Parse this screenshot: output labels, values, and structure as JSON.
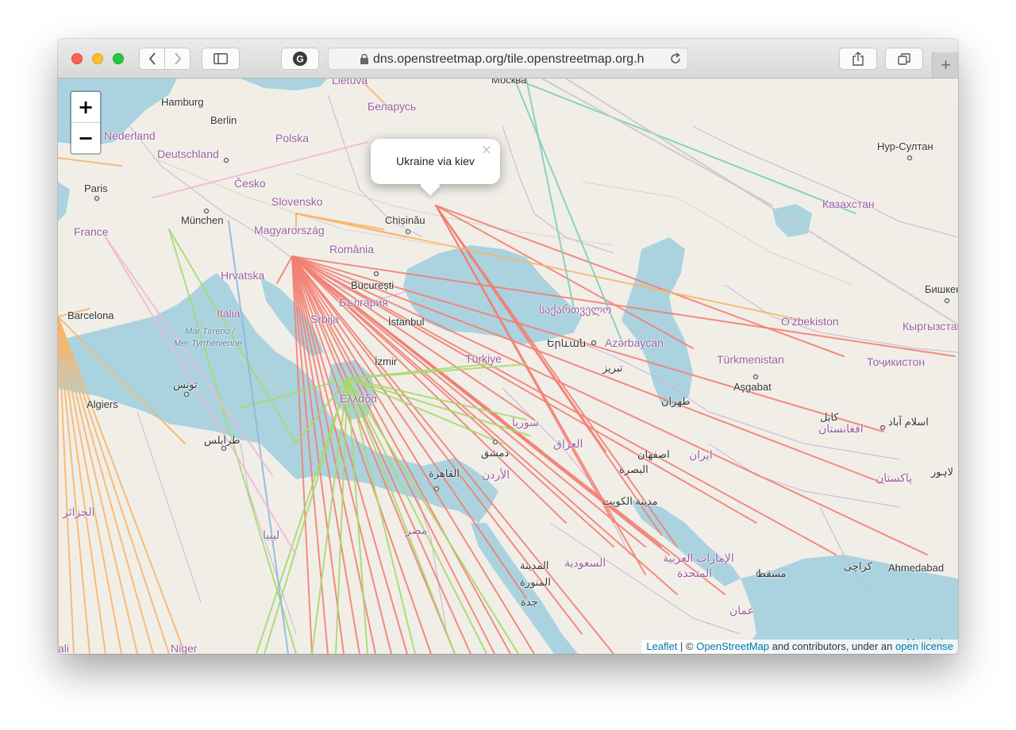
{
  "browser": {
    "url": "dns.openstreetmap.org/tile.openstreetmap.org.h",
    "new_tab_glyph": "+"
  },
  "map": {
    "zoom_in": "+",
    "zoom_out": "−",
    "popup": {
      "text": "Ukraine via kiev",
      "close": "×"
    },
    "attribution": {
      "leaflet": "Leaflet",
      "sep": " | © ",
      "osm": "OpenStreetMap",
      "middle": " and contributors, under an ",
      "license": "open license"
    },
    "labels": [
      {
        "text": "Hamburg",
        "cls": "lbl"
      },
      {
        "text": "Berlin",
        "cls": "lbl"
      },
      {
        "text": "Nederland",
        "cls": "lbl country"
      },
      {
        "text": "Deutschland",
        "cls": "lbl country"
      },
      {
        "text": "Polska",
        "cls": "lbl country"
      },
      {
        "text": "Беларусь",
        "cls": "lbl country"
      },
      {
        "text": "Česko",
        "cls": "lbl country"
      },
      {
        "text": "Slovensko",
        "cls": "lbl country"
      },
      {
        "text": "Paris",
        "cls": "lbl"
      },
      {
        "text": "München",
        "cls": "lbl"
      },
      {
        "text": "France",
        "cls": "lbl country"
      },
      {
        "text": "Magyarország",
        "cls": "lbl country"
      },
      {
        "text": "Chișinău",
        "cls": "lbl"
      },
      {
        "text": "România",
        "cls": "lbl country"
      },
      {
        "text": "Hrvatska",
        "cls": "lbl country"
      },
      {
        "text": "București",
        "cls": "lbl"
      },
      {
        "text": "България",
        "cls": "lbl country"
      },
      {
        "text": "Italia",
        "cls": "lbl country"
      },
      {
        "text": "Barcelona",
        "cls": "lbl"
      },
      {
        "text": "İstanbul",
        "cls": "lbl"
      },
      {
        "text": "Mar Tirreno /",
        "cls": "lbl water"
      },
      {
        "text": "Mer Tyrrhénienne",
        "cls": "lbl water"
      },
      {
        "text": "საქართველო",
        "cls": "lbl country"
      },
      {
        "text": "Երևան",
        "cls": "lbl"
      },
      {
        "text": "Azərbaycan",
        "cls": "lbl country"
      },
      {
        "text": "Türkiye",
        "cls": "lbl country"
      },
      {
        "text": "İzmir",
        "cls": "lbl"
      },
      {
        "text": "تبريز",
        "cls": "lbl"
      },
      {
        "text": "Türkmenistan",
        "cls": "lbl country"
      },
      {
        "text": "Aşgabat",
        "cls": "lbl"
      },
      {
        "text": "Нур-Султан",
        "cls": "lbl"
      },
      {
        "text": "Казахстан",
        "cls": "lbl country"
      },
      {
        "text": "O'zbekiston",
        "cls": "lbl country"
      },
      {
        "text": "Кыргызстан",
        "cls": "lbl country"
      },
      {
        "text": "Бишкек",
        "cls": "lbl"
      },
      {
        "text": "Тоҷикистон",
        "cls": "lbl country"
      },
      {
        "text": "تونس",
        "cls": "lbl"
      },
      {
        "text": "Algiers",
        "cls": "lbl"
      },
      {
        "text": "طرابلس",
        "cls": "lbl"
      },
      {
        "text": "سوريا",
        "cls": "lbl country"
      },
      {
        "text": "دمشق",
        "cls": "lbl"
      },
      {
        "text": "العراق",
        "cls": "lbl country"
      },
      {
        "text": "الأردن",
        "cls": "lbl country"
      },
      {
        "text": "طهران",
        "cls": "lbl"
      },
      {
        "text": "اصفهان",
        "cls": "lbl"
      },
      {
        "text": "ایران",
        "cls": "lbl country"
      },
      {
        "text": "کابل",
        "cls": "lbl"
      },
      {
        "text": "افغانستان",
        "cls": "lbl country"
      },
      {
        "text": "اسلام آباد",
        "cls": "lbl"
      },
      {
        "text": "پاکستان",
        "cls": "lbl country"
      },
      {
        "text": "لاہور",
        "cls": "lbl"
      },
      {
        "text": "القاهرة",
        "cls": "lbl"
      },
      {
        "text": "البصرة",
        "cls": "lbl"
      },
      {
        "text": "مدينة الكويت",
        "cls": "lbl"
      },
      {
        "text": "مصر",
        "cls": "lbl country"
      },
      {
        "text": "ليبيا",
        "cls": "lbl country"
      },
      {
        "text": "الجزائر",
        "cls": "lbl country"
      },
      {
        "text": "السعودية",
        "cls": "lbl country"
      },
      {
        "text": "الإمارات العربية",
        "cls": "lbl country"
      },
      {
        "text": "المتحدة",
        "cls": "lbl country"
      },
      {
        "text": "مسقط",
        "cls": "lbl"
      },
      {
        "text": "عمان",
        "cls": "lbl country"
      },
      {
        "text": "المدينة",
        "cls": "lbl"
      },
      {
        "text": "المنورة",
        "cls": "lbl"
      },
      {
        "text": "جدة",
        "cls": "lbl"
      },
      {
        "text": "کراچی",
        "cls": "lbl"
      },
      {
        "text": "Ahmedabad",
        "cls": "lbl"
      },
      {
        "text": "Niger",
        "cls": "lbl country"
      },
      {
        "text": "ali",
        "cls": "lbl country"
      },
      {
        "text": "Lietuva",
        "cls": "lbl country"
      },
      {
        "text": "Москва",
        "cls": "lbl"
      },
      {
        "text": "Mumbai",
        "cls": "lbl"
      },
      {
        "text": "Srbija",
        "cls": "lbl country"
      },
      {
        "text": "Ελλάδα",
        "cls": "lbl country"
      }
    ]
  },
  "colors": {
    "route_red": "#f28073",
    "route_orange": "#f7b56a",
    "route_green": "#a6d96a",
    "route_teal": "#7ecdbb",
    "route_gray": "#c9c9c9",
    "water": "#aad3df",
    "land": "#f1eee8"
  }
}
